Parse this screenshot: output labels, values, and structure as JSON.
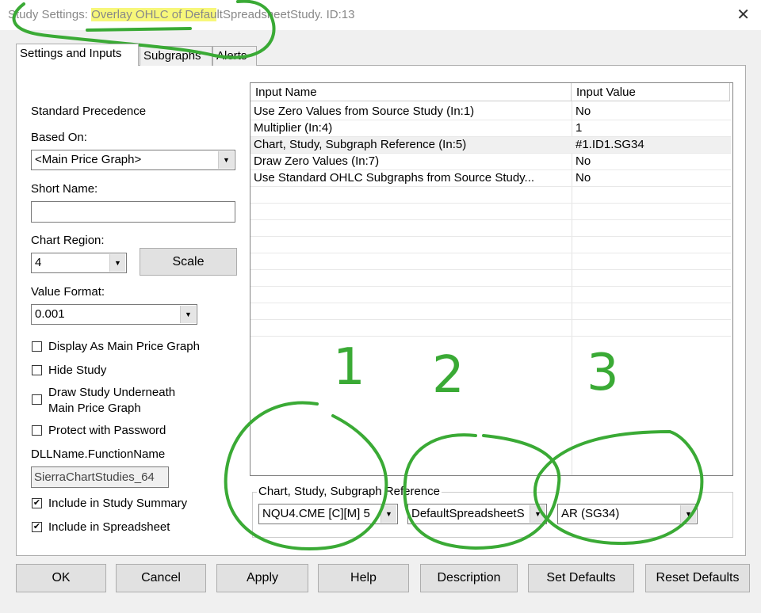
{
  "title": {
    "prefix": "Study Settings: ",
    "highlight": "Overlay OHLC of Defau",
    "suffix": "ltSpreadsheetStudy. ID:13"
  },
  "tabs": [
    "Settings and Inputs",
    "Subgraphs",
    "Alerts"
  ],
  "left": {
    "standard_precedence": "Standard Precedence",
    "based_on_label": "Based On:",
    "based_on_value": "<Main Price Graph>",
    "short_name_label": "Short Name:",
    "short_name_value": "",
    "chart_region_label": "Chart Region:",
    "chart_region_value": "4",
    "scale_button": "Scale",
    "value_format_label": "Value Format:",
    "value_format_value": "0.001",
    "checkboxes": [
      {
        "label": "Display As Main Price Graph",
        "checked": false
      },
      {
        "label": "Hide Study",
        "checked": false
      },
      {
        "label": "Draw Study Underneath",
        "label2": "Main Price Graph",
        "checked": false
      },
      {
        "label": "Protect with Password",
        "checked": false
      }
    ],
    "dll_label": "DLLName.FunctionName",
    "dll_value": "SierraChartStudies_64",
    "include_summary": {
      "label": "Include in Study Summary",
      "checked": true
    },
    "include_spreadsheet": {
      "label": "Include in Spreadsheet",
      "checked": true
    }
  },
  "table": {
    "headers": [
      "Input Name",
      "Input Value"
    ],
    "rows": [
      {
        "name": "Use Zero Values from Source Study   (In:1)",
        "value": "No"
      },
      {
        "name": "Multiplier   (In:4)",
        "value": "1"
      },
      {
        "name": "Chart, Study, Subgraph Reference   (In:5)",
        "value": "#1.ID1.SG34"
      },
      {
        "name": "Draw Zero Values   (In:7)",
        "value": "No"
      },
      {
        "name": "Use Standard OHLC Subgraphs from Source Study...",
        "value": "No"
      }
    ]
  },
  "reference": {
    "label": "Chart, Study, Subgraph Reference",
    "chart": "NQU4.CME [C][M]  5",
    "study": "DefaultSpreadsheetS",
    "subgraph": "AR (SG34)"
  },
  "annotations": [
    "1",
    "2",
    "3"
  ],
  "buttons": [
    "OK",
    "Cancel",
    "Apply",
    "Help",
    "Description",
    "Set Defaults",
    "Reset Defaults"
  ],
  "colors": {
    "annotation": "#3aaa35",
    "highlight": "#f7f77a"
  }
}
